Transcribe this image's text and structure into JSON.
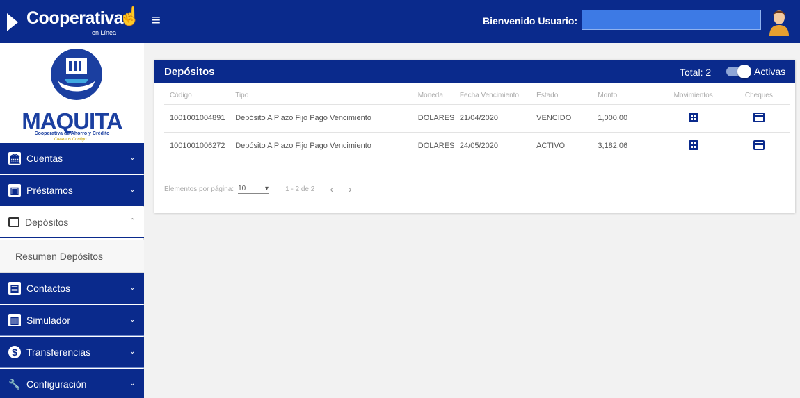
{
  "header": {
    "brand_name": "Cooperativa",
    "brand_sub": "en Línea",
    "welcome_label": "Bienvenido Usuario:",
    "user_value": "",
    "colors": {
      "primary": "#0a2a8c",
      "user_box": "#3d7ae5"
    }
  },
  "sidebar": {
    "logo": {
      "name": "MAQUITA",
      "subtitle": "Cooperativa de Ahorro y Crédito",
      "slogan": "Creamos Contigo..."
    },
    "items": [
      {
        "label": "Cuentas",
        "icon": "bank-icon"
      },
      {
        "label": "Préstamos",
        "icon": "loan-icon"
      },
      {
        "label": "Depósitos",
        "icon": "card-icon",
        "expanded": true
      },
      {
        "label": "Contactos",
        "icon": "contacts-icon"
      },
      {
        "label": "Simulador",
        "icon": "chart-icon"
      },
      {
        "label": "Transferencias",
        "icon": "dollar-icon"
      },
      {
        "label": "Configuración",
        "icon": "wrench-icon"
      }
    ],
    "sub_items": [
      {
        "label": "Resumen Depósitos"
      }
    ]
  },
  "deposits": {
    "title": "Depósitos",
    "total_label": "Total: 2",
    "toggle_label": "Activas",
    "toggle_on": true,
    "columns": [
      "Código",
      "Tipo",
      "Moneda",
      "Fecha Vencimiento",
      "Estado",
      "Monto",
      "Movimientos",
      "Cheques"
    ],
    "rows": [
      {
        "codigo": "1001001004891",
        "tipo": "Depósito A Plazo Fijo Pago Vencimiento",
        "moneda": "DOLARES",
        "fecha": "21/04/2020",
        "estado": "VENCIDO",
        "monto": "1,000.00"
      },
      {
        "codigo": "1001001006272",
        "tipo": "Depósito A Plazo Fijo Pago Vencimiento",
        "moneda": "DOLARES",
        "fecha": "24/05/2020",
        "estado": "ACTIVO",
        "monto": "3,182.06"
      }
    ],
    "pager": {
      "items_label": "Elementos por página:",
      "page_size": "10",
      "range": "1 - 2 de 2"
    }
  }
}
